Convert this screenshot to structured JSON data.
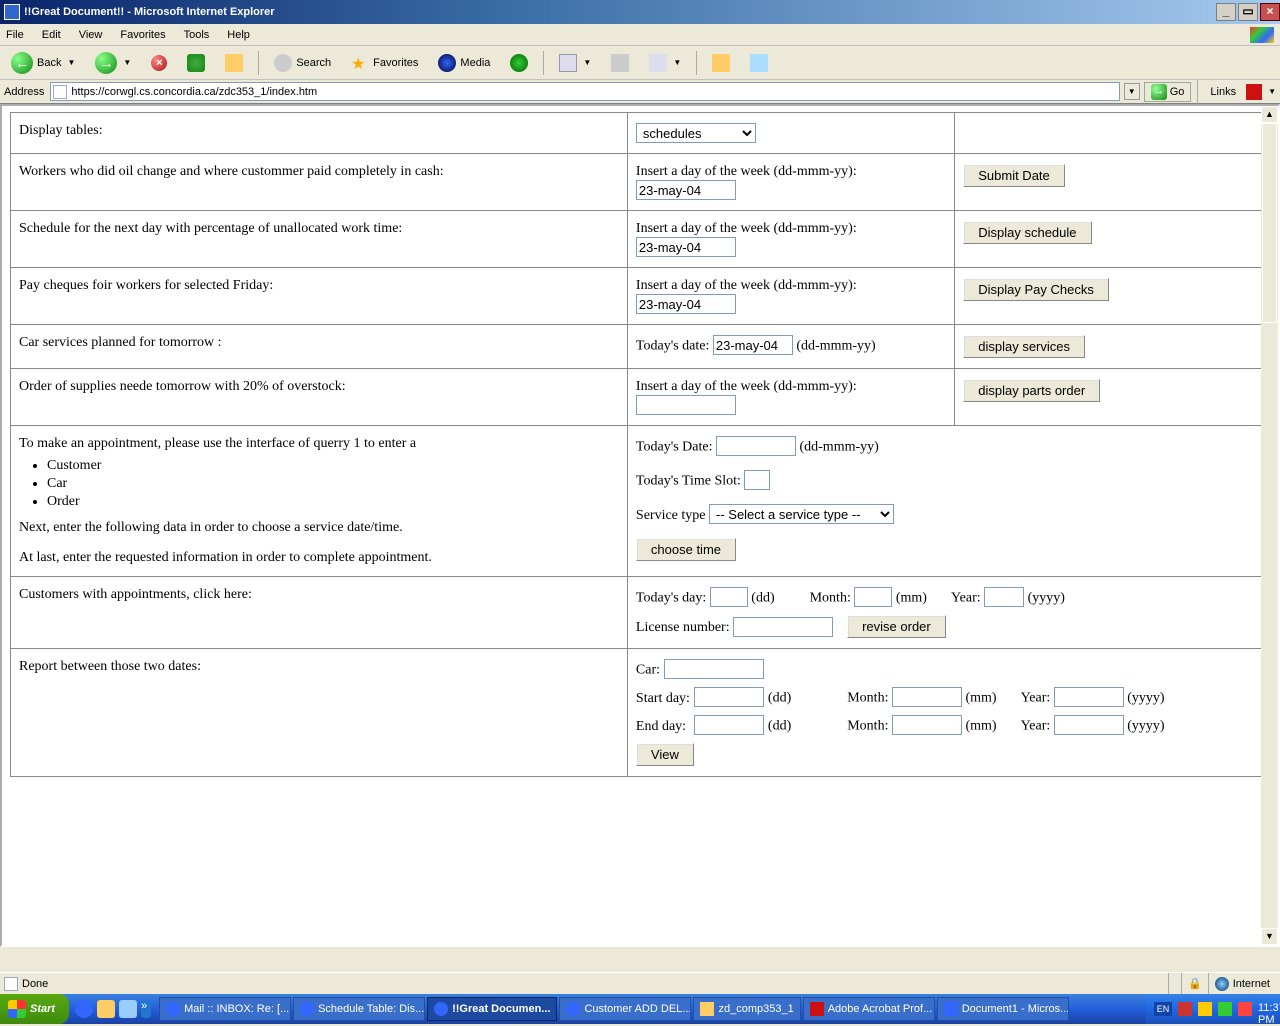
{
  "window": {
    "title": "!!Great Document!! - Microsoft Internet Explorer"
  },
  "menu": {
    "file": "File",
    "edit": "Edit",
    "view": "View",
    "favorites": "Favorites",
    "tools": "Tools",
    "help": "Help"
  },
  "toolbar": {
    "back": "Back",
    "search": "Search",
    "favorites": "Favorites",
    "media": "Media"
  },
  "address": {
    "label": "Address",
    "url": "https://corwgl.cs.concordia.ca/zdc353_1/index.htm",
    "go": "Go",
    "links": "Links"
  },
  "rows": {
    "r1": {
      "label": "Display tables:",
      "select": "schedules"
    },
    "r2": {
      "label": "Workers who did oil change and where custommer paid completely in cash:",
      "hint": "Insert a day of the week (dd-mmm-yy):",
      "value": "23-may-04",
      "btn": "Submit Date"
    },
    "r3": {
      "label": "Schedule for the next day with percentage of unallocated work time:",
      "hint": "Insert a day of the week (dd-mmm-yy):",
      "value": "23-may-04",
      "btn": "Display schedule"
    },
    "r4": {
      "label": "Pay cheques foir workers for selected Friday:",
      "hint": "Insert a day of the week (dd-mmm-yy):",
      "value": "23-may-04",
      "btn": "Display Pay Checks"
    },
    "r5": {
      "label": "Car services planned for tomorrow :",
      "datelbl": "Today's date:",
      "value": "23-may-04",
      "fmt": "(dd-mmm-yy)",
      "btn": "display services"
    },
    "r6": {
      "label": "Order of supplies neede tomorrow with 20% of overstock:",
      "hint": "Insert a day of the week (dd-mmm-yy):",
      "value": "",
      "btn": "display parts order"
    },
    "r7": {
      "intro": "To make an appointment, please use the interface of querry 1 to enter a",
      "li1": "Customer",
      "li2": "Car",
      "li3": "Order",
      "para2": "Next, enter the following data in order to choose a service date/time.",
      "para3": "At last, enter the requested information in order to complete appointment.",
      "datelbl": "Today's Date:",
      "fmt": "(dd-mmm-yy)",
      "slotlbl": "Today's Time Slot:",
      "svclbl": "Service type",
      "svcsel": "-- Select a service type --",
      "btn": "choose time"
    },
    "r8": {
      "label": "Customers with appointments, click here:",
      "daylbl": "Today's day:",
      "dd": "(dd)",
      "monlbl": "Month:",
      "mm": "(mm)",
      "yrlbl": "Year:",
      "yy": "(yyyy)",
      "liclbl": "License number:",
      "btn": "revise order"
    },
    "r9": {
      "label": "Report between those two dates:",
      "carlbl": "Car:",
      "sdlbl": "Start day:",
      "edlbl": "End day:",
      "dd": "(dd)",
      "monlbl": "Month:",
      "mm": "(mm)",
      "yrlbl": "Year:",
      "yy": "(yyyy)",
      "btn": "View"
    }
  },
  "status": {
    "done": "Done",
    "zone": "Internet"
  },
  "taskbar": {
    "start": "Start",
    "t1": "Mail :: INBOX: Re: [...",
    "t2": "Schedule Table: Dis...",
    "t3": "!!Great Documen...",
    "t4": "Customer ADD DEL...",
    "t5": "zd_comp353_1",
    "t6": "Adobe Acrobat Prof...",
    "t7": "Document1 - Micros...",
    "lang": "EN",
    "clock": "11:37 PM"
  }
}
